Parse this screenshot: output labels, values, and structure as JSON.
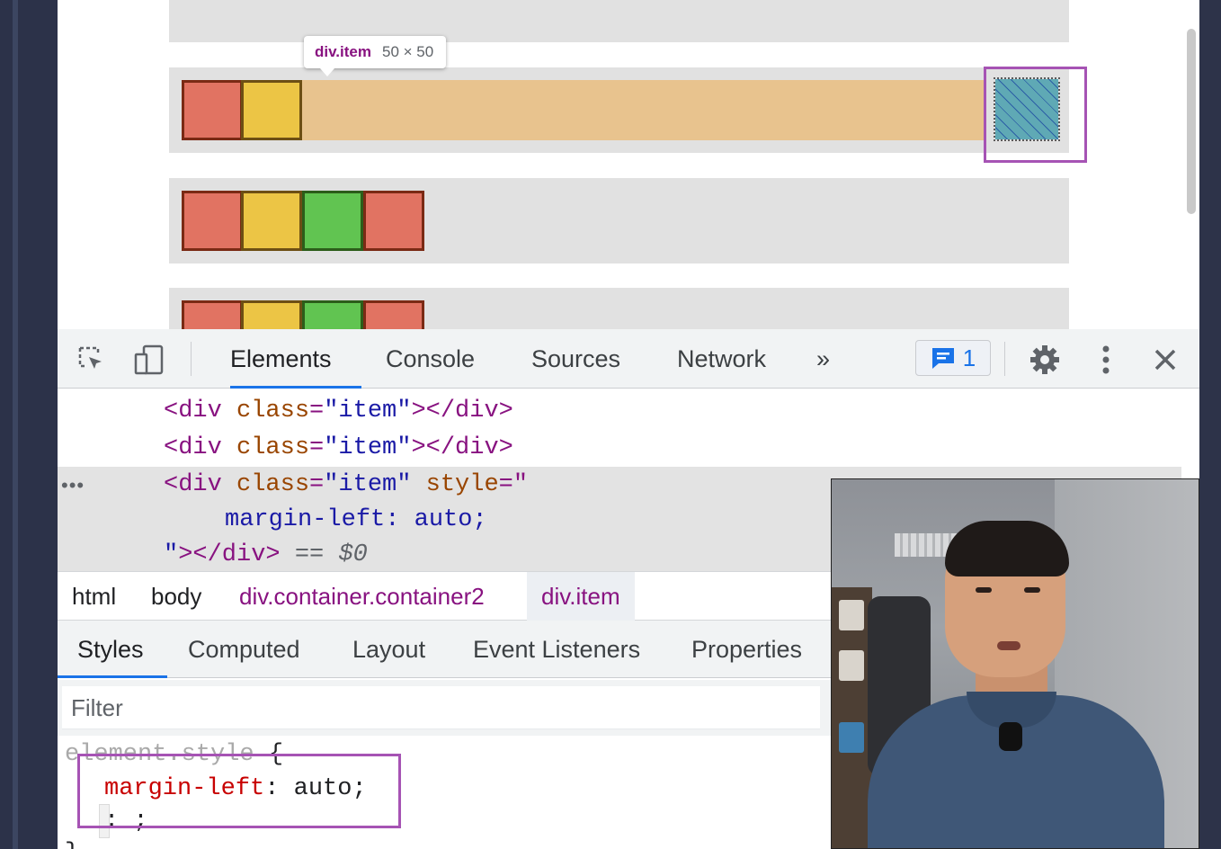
{
  "tooltip": {
    "tag": "div.item",
    "dimensions": "50 × 50"
  },
  "devtools": {
    "tabs": [
      "Elements",
      "Console",
      "Sources",
      "Network"
    ],
    "more_tabs_glyph": "»",
    "issues_count": "1",
    "icons": [
      "inspect-element-icon",
      "device-toolbar-icon",
      "issues-icon",
      "settings-gear-icon",
      "more-options-icon",
      "close-icon"
    ]
  },
  "dom": {
    "line1": {
      "open": "<div ",
      "attr": "class",
      "eq": "=",
      "value": "\"item\"",
      "close": "></div>"
    },
    "line2": {
      "open": "<div ",
      "attr": "class",
      "eq": "=",
      "value": "\"item\"",
      "close": "></div>"
    },
    "line3": {
      "open": "<div ",
      "attr": "class",
      "eq": "=",
      "value": "\"item\"",
      "attr2": " style",
      "eq2": "=\""
    },
    "line4": "margin-left: auto;",
    "line5": {
      "quote": "\"",
      "close": "></div>",
      "eq": " == ",
      "var": "$0"
    },
    "ellipsis": "•••"
  },
  "breadcrumbs": [
    "html",
    "body",
    "div.container.container2",
    "div.item"
  ],
  "style_tabs": [
    "Styles",
    "Computed",
    "Layout",
    "Event Listeners",
    "Properties"
  ],
  "filter": {
    "placeholder": "Filter"
  },
  "styles_pane": {
    "selector": "element.style",
    "open_brace": " {",
    "property": "margin-left",
    "colon": ": ",
    "value": "auto",
    "semicolon": ";",
    "empty": ": ;",
    "close_brace": "}"
  },
  "colors": {
    "item_red": "#e17362",
    "item_yellow": "#ecc545",
    "item_green": "#61c451",
    "container_bg": "#e1e1e1",
    "flex_highlight": "#e8c38e",
    "annotation_purple": "#a653b4",
    "devtools_accent": "#1a73e8"
  }
}
